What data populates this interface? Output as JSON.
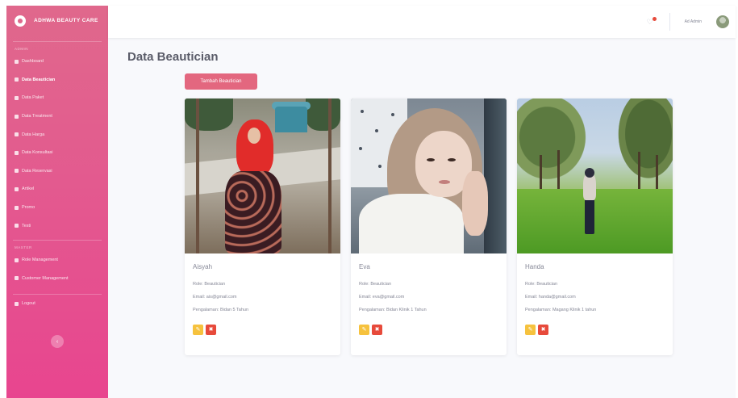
{
  "sidebar": {
    "brand": "ADHWA BEAUTY CARE",
    "sections": [
      "Admin",
      "Master"
    ],
    "items": [
      {
        "label": "Dashboard",
        "icon": "dashboard-icon"
      },
      {
        "label": "Data Beautician",
        "icon": "users-icon",
        "active": true
      },
      {
        "label": "Data Paket",
        "icon": "box-icon"
      },
      {
        "label": "Data Treatment",
        "icon": "spa-icon"
      },
      {
        "label": "Data Harga",
        "icon": "tag-icon"
      },
      {
        "label": "Data Konsultasi",
        "icon": "chat-icon"
      },
      {
        "label": "Data Reservasi",
        "icon": "calendar-icon"
      },
      {
        "label": "Artikel",
        "icon": "file-icon"
      },
      {
        "label": "Promo",
        "icon": "gift-icon"
      },
      {
        "label": "Testi",
        "icon": "star-icon"
      }
    ],
    "items2": [
      {
        "label": "Role Management",
        "icon": "key-icon"
      },
      {
        "label": "Customer Management",
        "icon": "user-cog-icon"
      }
    ],
    "logout": "Logout",
    "toggle": "‹"
  },
  "topbar": {
    "user_name": "Ad Admin",
    "colors": {
      "bell_dot": "#e74a3b"
    }
  },
  "page": {
    "title": "Data Beautician",
    "add_button": "Tambah Beautician"
  },
  "beauticians": [
    {
      "name": "Aisyah",
      "role": "Role: Beautician",
      "email": "Email: ais@gmail.com",
      "experience": "Pengalaman: Bidan 5 Tahun"
    },
    {
      "name": "Eva",
      "role": "Role: Beautician",
      "email": "Email: eva@gmail.com",
      "experience": "Pengalaman: Bidan Klinik 1 Tahun"
    },
    {
      "name": "Handa",
      "role": "Role: Beautician",
      "email": "Email: handa@gmail.com",
      "experience": "Pengalaman: Magang Klinik 1 tahun"
    }
  ],
  "colors": {
    "sidebar_top": "#e0688c",
    "sidebar_bottom": "#e8458f",
    "accent_button": "#e3677f",
    "edit": "#f6c23e",
    "delete": "#e74a3b"
  }
}
